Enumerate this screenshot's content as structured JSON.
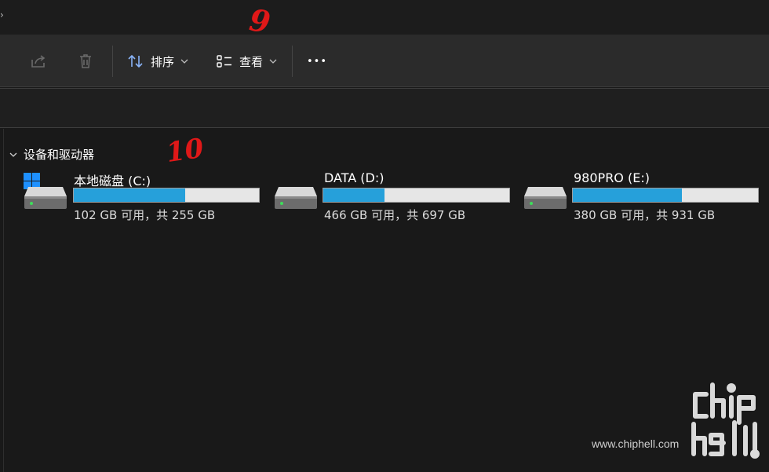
{
  "toolbar": {
    "share_label": "",
    "delete_label": "",
    "sort_label": "排序",
    "view_label": "查看",
    "more_label": "•••"
  },
  "group": {
    "title": "设备和驱动器"
  },
  "drives": [
    {
      "name": "本地磁盘 (C:)",
      "free_text": "102 GB 可用，共 255 GB",
      "used_fraction": 0.6
    },
    {
      "name": "DATA (D:)",
      "free_text": "466 GB 可用，共 697 GB",
      "used_fraction": 0.33
    },
    {
      "name": "980PRO (E:)",
      "free_text": "380 GB 可用，共 931 GB",
      "used_fraction": 0.59
    }
  ],
  "annotations": {
    "a9": "9",
    "a10": "10"
  },
  "watermark": {
    "url": "www.chiphell.com"
  },
  "colors": {
    "accent": "#26a0da",
    "background": "#191919",
    "toolbar": "#2b2b2b",
    "annotation": "#e01818"
  }
}
